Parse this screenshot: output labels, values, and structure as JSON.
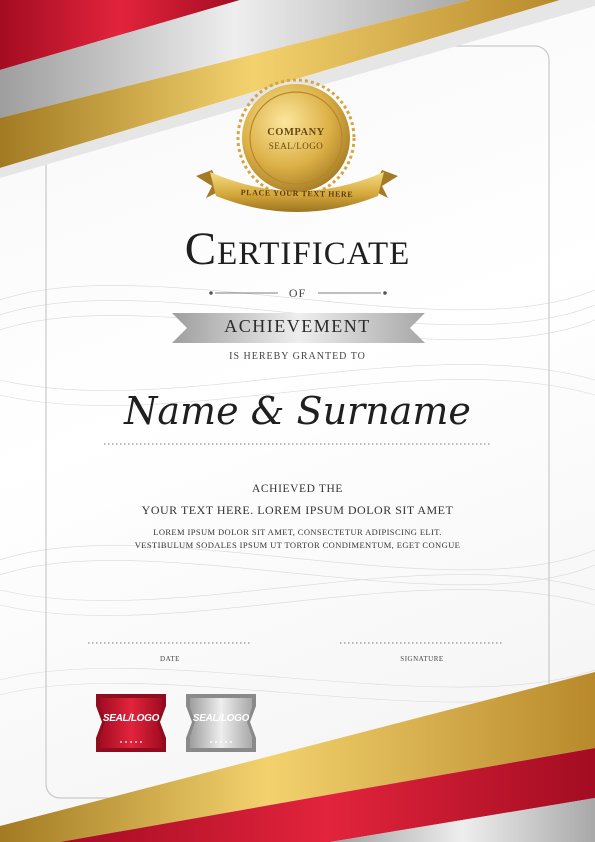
{
  "seal": {
    "line1": "COMPANY",
    "line2": "SEAL/LOGO",
    "ribbon": "PLACE YOUR TEXT HERE"
  },
  "certificate": {
    "title": "Certificate",
    "of": "OF",
    "subtitle": "ACHIEVEMENT",
    "granted": "IS HEREBY GRANTED TO",
    "name": "Name & Surname",
    "achieved": "ACHIEVED THE",
    "your_text": "YOUR TEXT HERE. LOREM IPSUM DOLOR SIT AMET",
    "lorem_line1": "LOREM IPSUM DOLOR SIT AMET, CONSECTETUR ADIPISCING ELIT.",
    "lorem_line2": "VESTIBULUM SODALES IPSUM UT TORTOR CONDIMENTUM, EGET CONGUE"
  },
  "footer": {
    "date_label": "DATE",
    "signature_label": "SIGNATURE",
    "badge_red": "SEAL/LOGO",
    "badge_silver": "SEAL/LOGO"
  },
  "colors": {
    "red": "#c8102e",
    "gold": "#d9ae3f",
    "silver": "#c4c4c4"
  }
}
